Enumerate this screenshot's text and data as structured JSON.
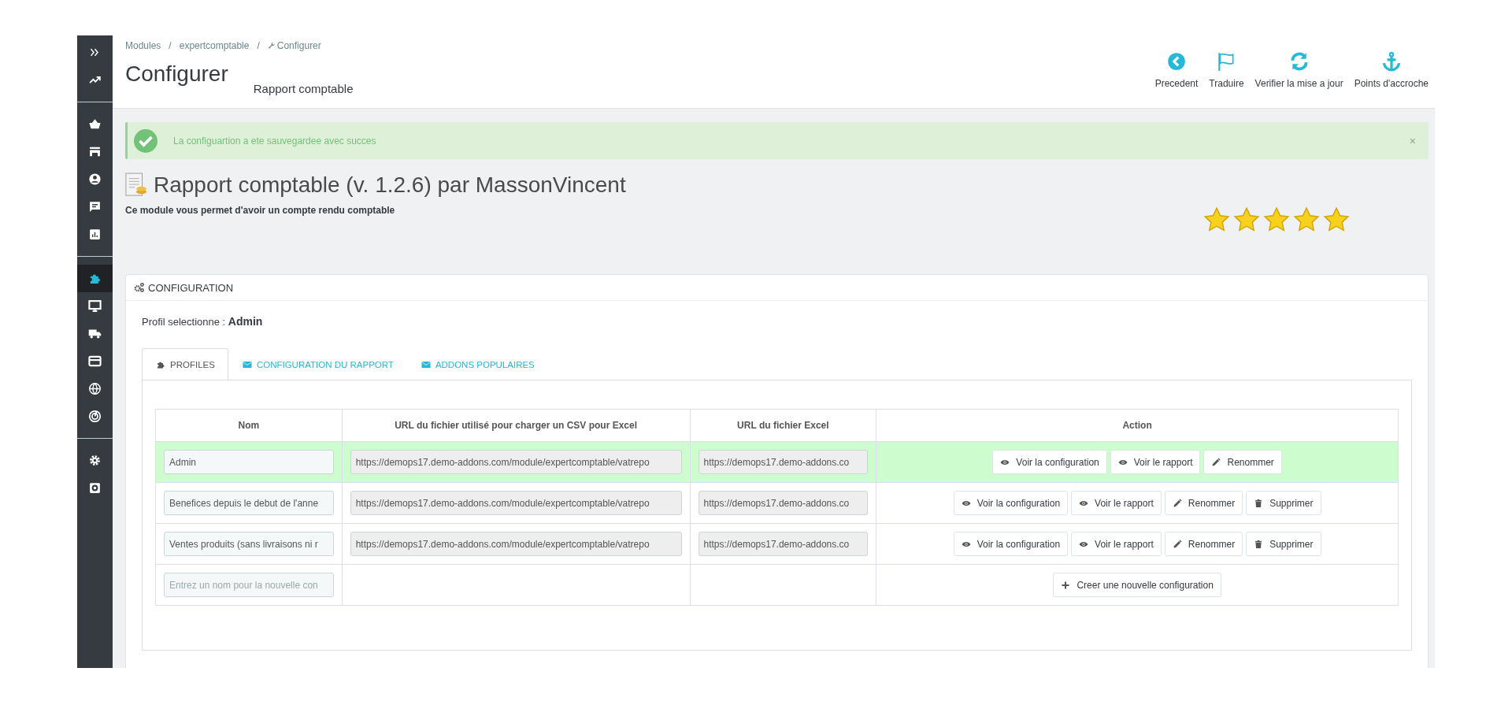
{
  "sidebar": {
    "groups": [
      {
        "items": [
          {
            "kind": "expand",
            "selected": false
          },
          {
            "kind": "trend",
            "selected": false
          }
        ]
      },
      {
        "items": [
          {
            "kind": "basket",
            "selected": false
          },
          {
            "kind": "store",
            "selected": false
          },
          {
            "kind": "user",
            "selected": false
          },
          {
            "kind": "chat",
            "selected": false
          },
          {
            "kind": "stats",
            "selected": false
          }
        ]
      },
      {
        "items": [
          {
            "kind": "puzzle",
            "selected": true
          },
          {
            "kind": "monitor",
            "selected": false
          },
          {
            "kind": "truck",
            "selected": false
          },
          {
            "kind": "card",
            "selected": false
          },
          {
            "kind": "globe",
            "selected": false
          },
          {
            "kind": "radar",
            "selected": false
          }
        ]
      },
      {
        "items": [
          {
            "kind": "gear",
            "selected": false
          },
          {
            "kind": "gearbox",
            "selected": false
          }
        ]
      }
    ]
  },
  "breadcrumb": {
    "separator": "/",
    "items": [
      {
        "label": "Modules",
        "kind": "text"
      },
      {
        "label": "expertcomptable",
        "kind": "text"
      },
      {
        "label": "Configurer",
        "kind": "wrench"
      }
    ]
  },
  "page_title": "Configurer",
  "page_subtitle": "Rapport comptable",
  "toolbar": [
    {
      "kind": "back",
      "label": "Precedent"
    },
    {
      "kind": "flag",
      "label": "Traduire"
    },
    {
      "kind": "refresh",
      "label": "Verifier la mise a jour"
    },
    {
      "kind": "anchor",
      "label": "Points d'accroche"
    }
  ],
  "alert": {
    "message": "La configuartion a ete sauvegardee avec succes",
    "close": "×"
  },
  "module": {
    "title": "Rapport comptable (v. 1.2.6) par MassonVincent",
    "description": "Ce module vous permet d'avoir un compte rendu comptable",
    "stars": 5
  },
  "panel": {
    "title": "CONFIGURATION",
    "profile_label": "Profil selectionne :",
    "profile_value": "Admin",
    "tabs": [
      {
        "label": "PROFILES",
        "kind": "puzzle",
        "selected": true
      },
      {
        "label": "CONFIGURATION DU RAPPORT",
        "kind": "mail",
        "selected": false
      },
      {
        "label": "ADDONS POPULAIRES",
        "kind": "mail",
        "selected": false
      }
    ],
    "table": {
      "columns": [
        "Nom",
        "URL du fichier utilisé pour charger un CSV pour Excel",
        "URL du fichier Excel",
        "Action"
      ],
      "rows": [
        {
          "name": "Admin",
          "csv_url": "https://demops17.demo-addons.com/module/expertcomptable/vatrepo",
          "excel_url": "https://demops17.demo-addons.co",
          "selected": true,
          "actions": [
            {
              "kind": "view",
              "label": "Voir la configuration"
            },
            {
              "kind": "view",
              "label": "Voir le rapport"
            },
            {
              "kind": "rename",
              "label": "Renommer"
            }
          ]
        },
        {
          "name": "Benefices depuis le debut de l'anne",
          "csv_url": "https://demops17.demo-addons.com/module/expertcomptable/vatrepo",
          "excel_url": "https://demops17.demo-addons.co",
          "selected": false,
          "actions": [
            {
              "kind": "view",
              "label": "Voir la configuration"
            },
            {
              "kind": "view",
              "label": "Voir le rapport"
            },
            {
              "kind": "rename",
              "label": "Renommer"
            },
            {
              "kind": "delete",
              "label": "Supprimer"
            }
          ]
        },
        {
          "name": "Ventes produits (sans livraisons ni r",
          "csv_url": "https://demops17.demo-addons.com/module/expertcomptable/vatrepo",
          "excel_url": "https://demops17.demo-addons.co",
          "selected": false,
          "actions": [
            {
              "kind": "view",
              "label": "Voir la configuration"
            },
            {
              "kind": "view",
              "label": "Voir le rapport"
            },
            {
              "kind": "rename",
              "label": "Renommer"
            },
            {
              "kind": "delete",
              "label": "Supprimer"
            }
          ]
        }
      ],
      "new_row": {
        "placeholder": "Entrez un nom pour la nouvelle con",
        "action": {
          "kind": "create",
          "label": "Creer une nouvelle configuration"
        }
      }
    }
  }
}
